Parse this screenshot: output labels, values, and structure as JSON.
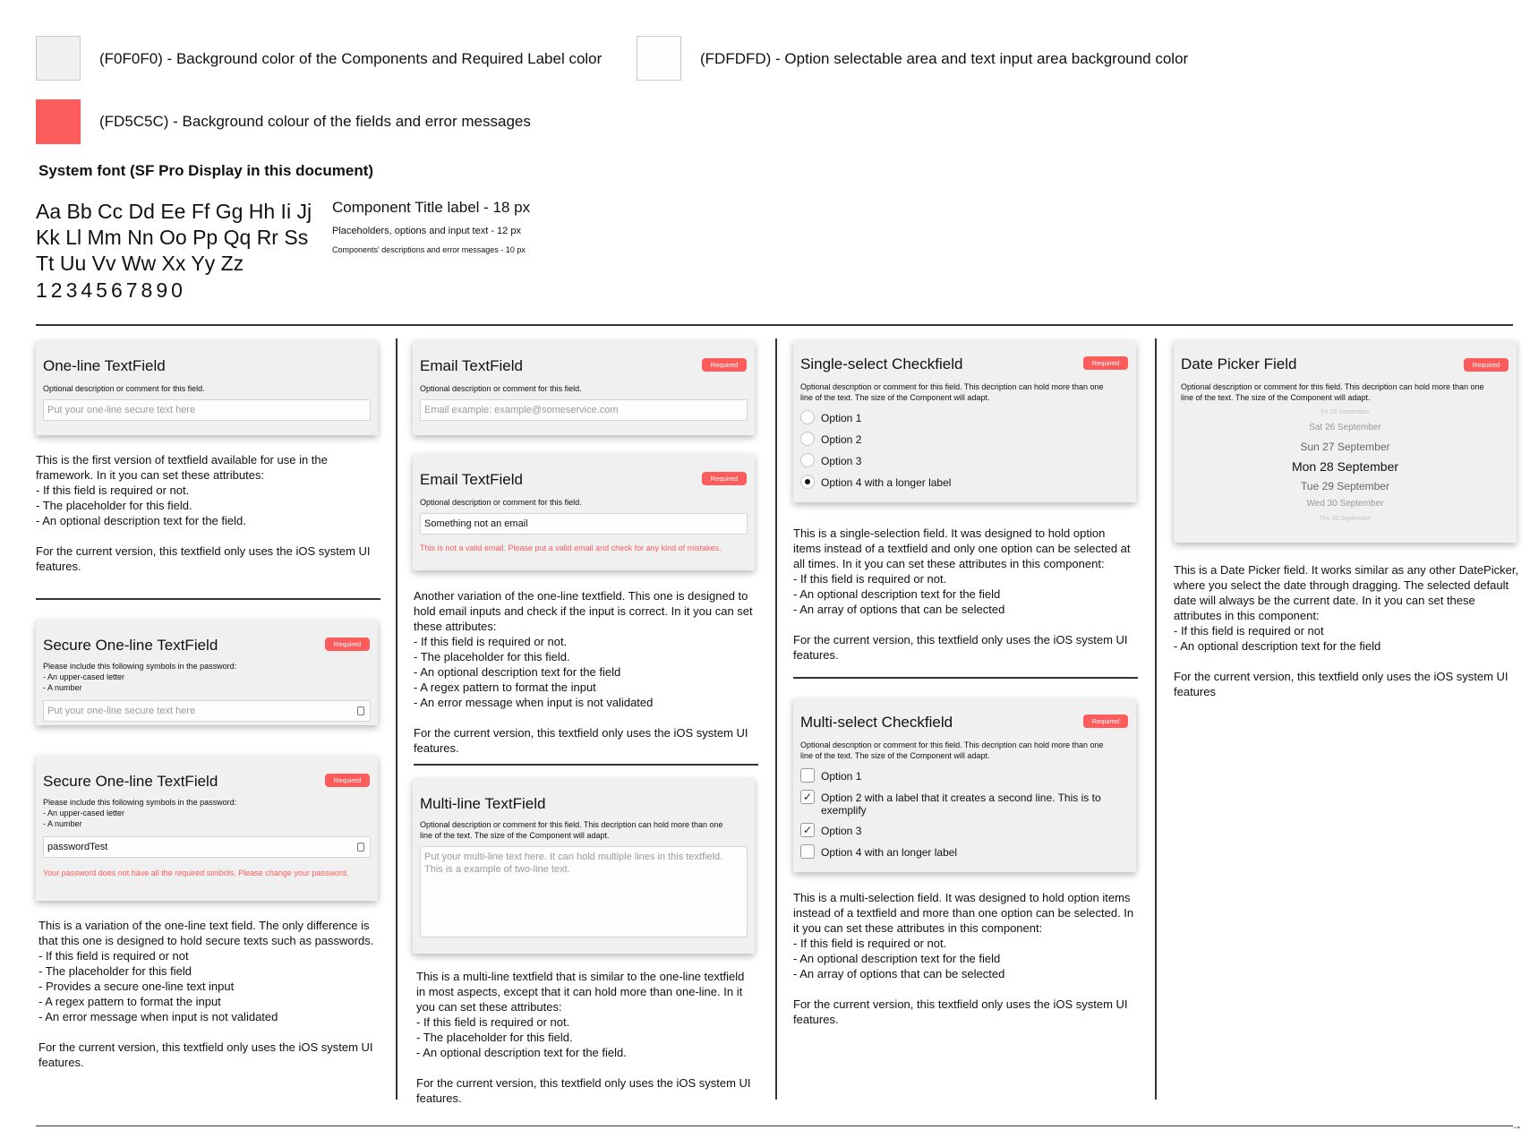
{
  "legend": {
    "items": [
      {
        "color": "#F0F0F0",
        "label": "(F0F0F0) - Background color of the Components and Required Label color"
      },
      {
        "color": "#FDFDFD",
        "label": "(FDFDFD) - Option selectable area and text input area background color"
      },
      {
        "color": "#FD5C5C",
        "label": "(FD5C5C) - Background colour of the fields and error messages"
      }
    ]
  },
  "typography": {
    "heading": "System font (SF Pro Display in this document)",
    "alphabet": [
      "Aa Bb Cc Dd Ee Ff Gg Hh Ii Jj",
      "Kk Ll Mm Nn Oo Pp Qq Rr Ss",
      "Tt Uu Vv Ww Xx Yy Zz"
    ],
    "numbers": "1234567890",
    "size_title": "Component Title label - 18 px",
    "size_placeholder": "Placeholders, options and input text - 12 px",
    "size_description": "Components' descriptions and error messages - 10 px"
  },
  "required_label": "Required",
  "oneline": {
    "title": "One-line TextField",
    "description": "Optional description or comment for this field.",
    "placeholder": "Put your one-line secure text here",
    "text": [
      "This is the first version of textfield available for use in the",
      "framework. In it you can set these attributes:",
      " - If this field is required or not.",
      " - The placeholder for this field.",
      " - An optional description text for the field.",
      "",
      "For the current version, this textfield only uses the iOS system UI",
      "features."
    ]
  },
  "secure1": {
    "title": "Secure One-line TextField",
    "description": [
      "Please include this following symbols in the password:",
      " - An upper-cased letter",
      " - A number"
    ],
    "placeholder": "Put your one-line secure text here"
  },
  "secure2": {
    "title": "Secure One-line TextField",
    "description": [
      "Please include this following symbols in the password:",
      " - An upper-cased letter",
      " - A number"
    ],
    "value": "passwordTest",
    "error": "Your password does not have all the required simbols. Please change your password.",
    "text": [
      "This is a variation of the one-line text field. The only difference is",
      "that this one is designed to hold secure texts such as passwords.",
      " - If this field is required or not",
      " - The placeholder for this field",
      " - Provides a secure one-line text input",
      " - A regex pattern to format the input",
      " - An error message when input is not validated",
      "",
      "For the current version, this textfield only uses the iOS system UI",
      "features."
    ]
  },
  "email1": {
    "title": "Email TextField",
    "description": "Optional description or comment for this field.",
    "placeholder": "Email example: example@someservice.com"
  },
  "email2": {
    "title": "Email TextField",
    "description": "Optional description or comment for this field.",
    "value": "Something not an email",
    "error": "This is not a valid email. Please put a valid email and check for any kind of mistakes.",
    "text": [
      "Another variation of the one-line textfield. This one is designed to",
      "hold email inputs and check if the input is correct. In it you can set",
      "these attributes:",
      " - If this field is required or not.",
      " - The placeholder for this field.",
      " - An optional description text for the field",
      " - A regex pattern to format the input",
      " - An error message when input is not validated",
      "",
      "For the current version, this textfield only uses the iOS system UI",
      "features."
    ]
  },
  "multiline": {
    "title": "Multi-line TextField",
    "description": [
      "Optional description or comment for this field. This decription can hold more than one",
      "line of the text. The size of the Component will adapt."
    ],
    "placeholder": [
      "Put your multi-line text here. It can hold multiple lines in this textfield.",
      "This is a example of two-line text."
    ],
    "text": [
      "This is a multi-line textfield that is similar to the one-line textfield",
      "in most aspects, except that it can hold more than one-line. In it",
      "you can set these attributes:",
      " - If this field is required or not.",
      " - The placeholder for this field.",
      " - An optional description text for the field.",
      "",
      "For the current version, this textfield only uses the iOS system UI",
      "features."
    ]
  },
  "single": {
    "title": "Single-select Checkfield",
    "description": [
      "Optional description or comment for this field. This decription can hold more than one",
      "line of the text. The size of the Component will adapt."
    ],
    "options": [
      "Option 1",
      "Option 2",
      "Option 3",
      "Option 4 with a longer label"
    ],
    "selected_index": 3,
    "text": [
      "This is a single-selection field. It was designed to hold option",
      "items instead of a textfield and only one option can be selected at",
      "all times. In it you can set these attributes in this component:",
      " - If this field is required or not.",
      " - An optional description text for the field",
      " - An array of options that can be selected",
      "",
      "For the current version, this textfield only uses the iOS system UI",
      "features."
    ]
  },
  "multi": {
    "title": "Multi-select Checkfield",
    "description": [
      "Optional description or comment for this field. This decription can hold more than one",
      "line of the text. The size of the Component will adapt."
    ],
    "options": [
      {
        "label": "Option 1",
        "checked": false
      },
      {
        "label": "Option 2 with a label that it creates a second line. This is to exemplify",
        "checked": true
      },
      {
        "label": "Option 3",
        "checked": true
      },
      {
        "label": "Option 4 with an longer label",
        "checked": false
      }
    ],
    "check_glyph": "✓",
    "text": [
      "This is a multi-selection field. It was designed to hold option items",
      "instead of a textfield and more than one option can be selected. In",
      "it you can set these attributes in this component:",
      " - If this field is required or not.",
      " - An optional description text for the field",
      " - An array of options that can be selected",
      "",
      "For the current version, this textfield only uses the iOS system UI",
      "features."
    ]
  },
  "datepicker": {
    "title": "Date Picker Field",
    "description": [
      "Optional description or comment for this field. This decription can hold more than one",
      "line of the text. The size of the Component will adapt."
    ],
    "dates": [
      "Fri 25 September",
      "Sat 26 September",
      "Sun 27 September",
      "Mon 28 September",
      "Tue 29 September",
      "Wed 30 September",
      "Thu 30 September"
    ],
    "selected_index": 3,
    "text": [
      "This is a Date Picker field. It works similar as any other DatePicker,",
      "where you select the date through dragging. The selected default",
      "date will always be the current date. In it you can set these",
      "attributes in this component:",
      " - If this field is required or not",
      " - An optional description text for the field",
      "",
      "For the current version, this textfield only uses the iOS system UI",
      "features"
    ]
  }
}
